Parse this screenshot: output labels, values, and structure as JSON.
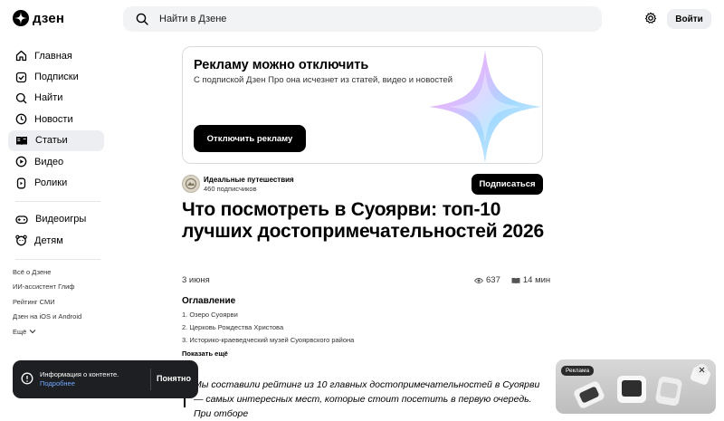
{
  "brand": {
    "name": "дзен"
  },
  "search": {
    "placeholder": "Найти в Дзене"
  },
  "header": {
    "login_label": "Войти"
  },
  "sidebar": {
    "items": [
      {
        "label": "Главная",
        "icon": "home-icon"
      },
      {
        "label": "Подписки",
        "icon": "subscriptions-icon"
      },
      {
        "label": "Найти",
        "icon": "search-icon"
      },
      {
        "label": "Новости",
        "icon": "news-icon"
      },
      {
        "label": "Статьи",
        "icon": "articles-icon",
        "active": true
      },
      {
        "label": "Видео",
        "icon": "video-icon"
      },
      {
        "label": "Ролики",
        "icon": "shorts-icon"
      }
    ],
    "items2": [
      {
        "label": "Видеоигры",
        "icon": "gamepad-icon"
      },
      {
        "label": "Детям",
        "icon": "kids-icon"
      }
    ],
    "links": [
      "Всё о Дзене",
      "ИИ-ассистент Глиф",
      "Рейтинг СМИ",
      "Дзен на iOS и Android",
      "Ещё"
    ]
  },
  "ad_banner": {
    "title": "Рекламу можно отключить",
    "subtitle": "С подпиской Дзен Про она исчезнет из статей, видео и новостей",
    "button": "Отключить рекламу"
  },
  "channel": {
    "name": "Идеальные путешествия",
    "subscribers": "460 подписчиков",
    "subscribe_label": "Подписаться"
  },
  "article": {
    "title": "Что посмотреть в Суоярви: топ-10 лучших достопримечательностей 2026",
    "date": "3 июня",
    "views": "637",
    "read_time": "14 мин",
    "toc_title": "Оглавление",
    "toc": [
      "1. Озеро Суоярви",
      "2. Церковь Рождества Христова",
      "3. Историко-краеведческий музей Суоярвского района"
    ],
    "toc_more": "Показать ещё",
    "intro": "Мы составили рейтинг из 10 главных достопримечательностей в Суоярви — самых интересных мест, которые стоит посетить в первую очередь. При отборе"
  },
  "toast": {
    "text": "Информация о контенте.",
    "link": "Подробнее",
    "ok": "Понятно"
  },
  "right_ad": {
    "label": "Реклама"
  },
  "colors": {
    "accent": "#000000",
    "link": "#6fa8ff",
    "active_bg": "#eceef1"
  }
}
